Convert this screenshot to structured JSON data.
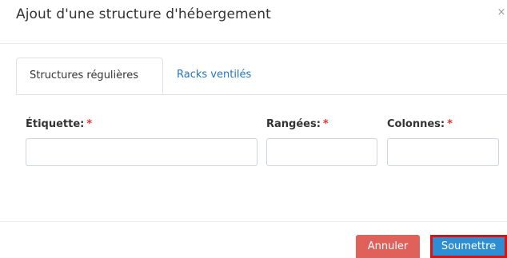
{
  "modal": {
    "title": "Ajout d'une structure d'hébergement",
    "close_icon": "×"
  },
  "tabs": [
    {
      "label": "Structures régulières",
      "active": true
    },
    {
      "label": "Racks ventilés",
      "active": false
    }
  ],
  "form": {
    "fields": [
      {
        "label": "Étiquette:",
        "required_mark": "*",
        "value": ""
      },
      {
        "label": "Rangées:",
        "required_mark": "*",
        "value": ""
      },
      {
        "label": "Colonnes:",
        "required_mark": "*",
        "value": ""
      }
    ]
  },
  "footer": {
    "cancel_label": "Annuler",
    "submit_label": "Soumettre"
  },
  "colors": {
    "link": "#2176bd",
    "required": "#e3342f",
    "cancel_bg": "#e0605a",
    "submit_bg": "#2d8ed4",
    "highlight": "#e01010"
  }
}
